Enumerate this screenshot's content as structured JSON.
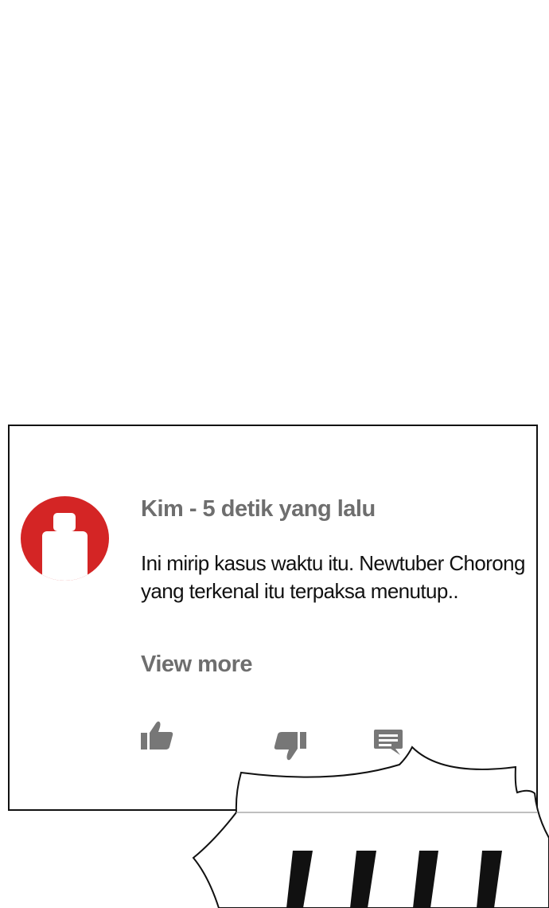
{
  "comment": {
    "author_line": "Kim - 5 detik yang lalu",
    "text": "Ini mirip kasus waktu itu. Newtuber Chorong yang terkenal itu terpaksa menutup..",
    "view_more_label": "View more",
    "avatar_color": "#d42525",
    "actions": {
      "like_icon": "thumbs-up-icon",
      "dislike_icon": "thumbs-down-icon",
      "reply_icon": "comment-icon"
    }
  },
  "colors": {
    "meta_text": "#6e6e6e",
    "body_text": "#111111",
    "icon_gray": "#777777"
  }
}
